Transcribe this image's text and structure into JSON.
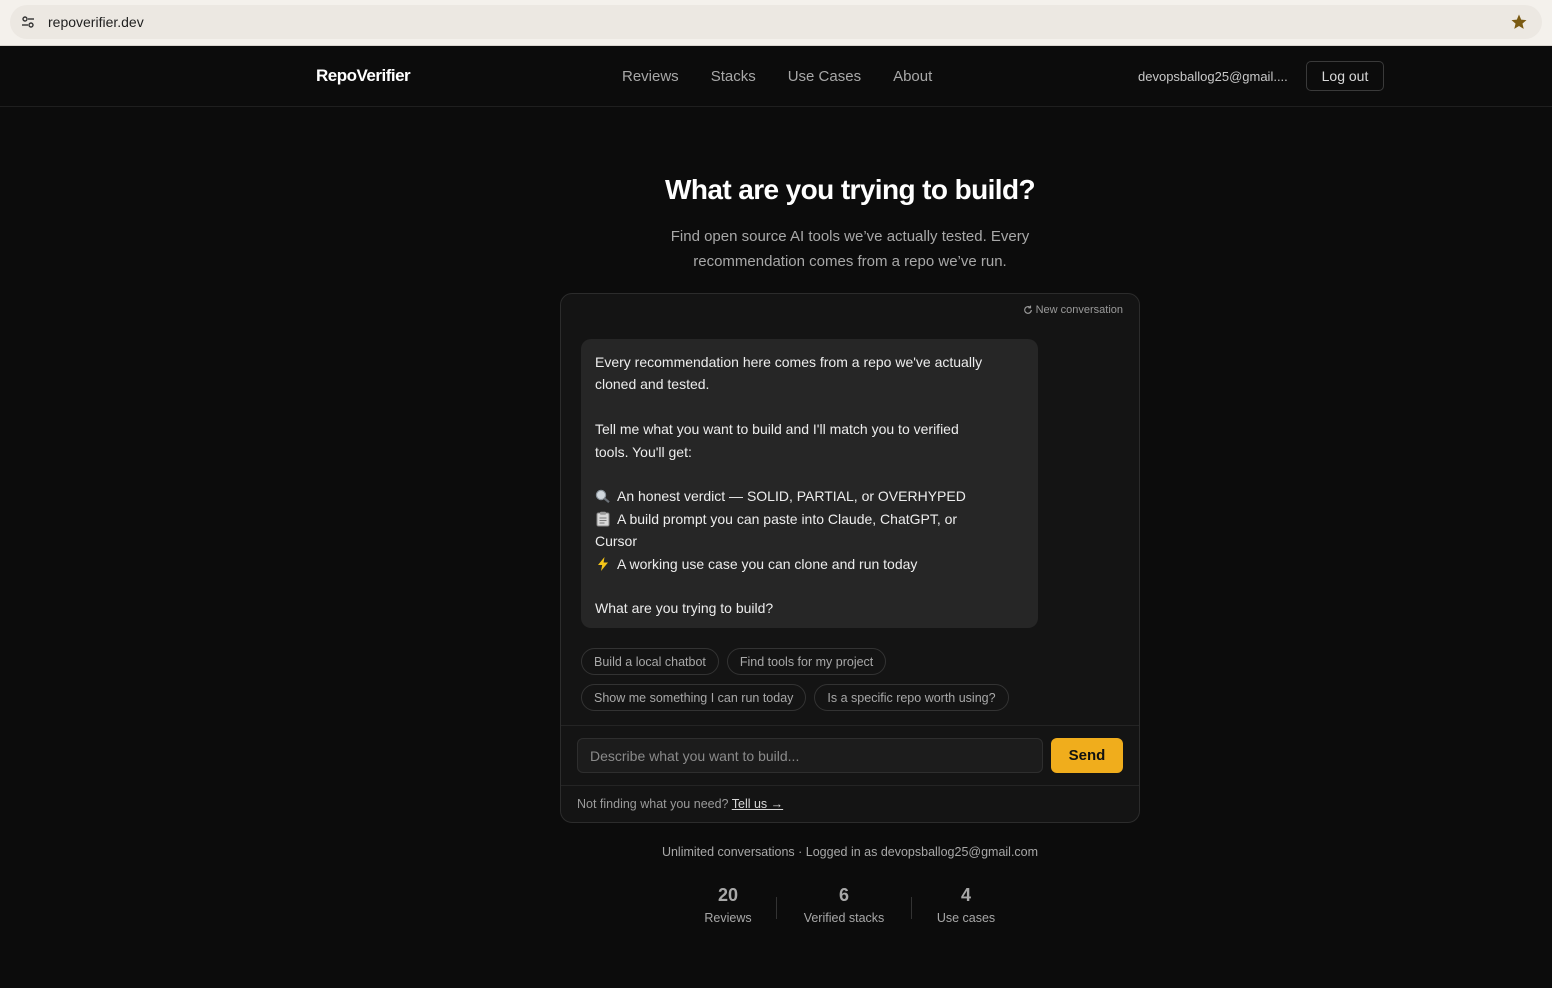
{
  "browser": {
    "url": "repoverifier.dev",
    "site_icon": "tune-icon",
    "bookmark_icon": "star-icon",
    "bookmark_color": "#7a5a12"
  },
  "nav": {
    "logo": "RepoVerifier",
    "links": [
      "Reviews",
      "Stacks",
      "Use Cases",
      "About"
    ],
    "user_email": "devopsballog25@gmail....",
    "logout_label": "Log out"
  },
  "hero": {
    "title": "What are you trying to build?",
    "subtitle_line1": "Find open source AI tools we’ve actually tested. Every",
    "subtitle_line2": "recommendation comes from a repo we’ve run."
  },
  "chat": {
    "new_conversation_label": "New conversation",
    "message": {
      "p1_line1": "Every recommendation here comes from a repo we've actually",
      "p1_line2": "cloned and tested.",
      "p2_line1": "Tell me what you want to build and I'll match you to verified",
      "p2_line2": "tools. You'll get:",
      "bullet1": "An honest verdict — SOLID, PARTIAL, or OVERHYPED",
      "bullet2_line1": "A build prompt you can paste into Claude, ChatGPT, or",
      "bullet2_line2": "Cursor",
      "bullet3": "A working use case you can clone and run today",
      "closing": "What are you trying to build?"
    },
    "chips_row1": [
      "Build a local chatbot",
      "Find tools for my project"
    ],
    "chips_row2": [
      "Show me something I can run today",
      "Is a specific repo worth using?"
    ],
    "input_placeholder": "Describe what you want to build...",
    "send_label": "Send",
    "not_finding_text": "Not finding what you need?",
    "tell_us_label": "Tell us →"
  },
  "footer_note": "Unlimited conversations · Logged in as devopsballog25@gmail.com",
  "stats": [
    {
      "value": "20",
      "label": "Reviews"
    },
    {
      "value": "6",
      "label": "Verified stacks"
    },
    {
      "value": "4",
      "label": "Use cases"
    }
  ],
  "colors": {
    "accent": "#f0ad1c",
    "background": "#0c0c0c",
    "card": "#141414",
    "bubble": "#262626"
  }
}
